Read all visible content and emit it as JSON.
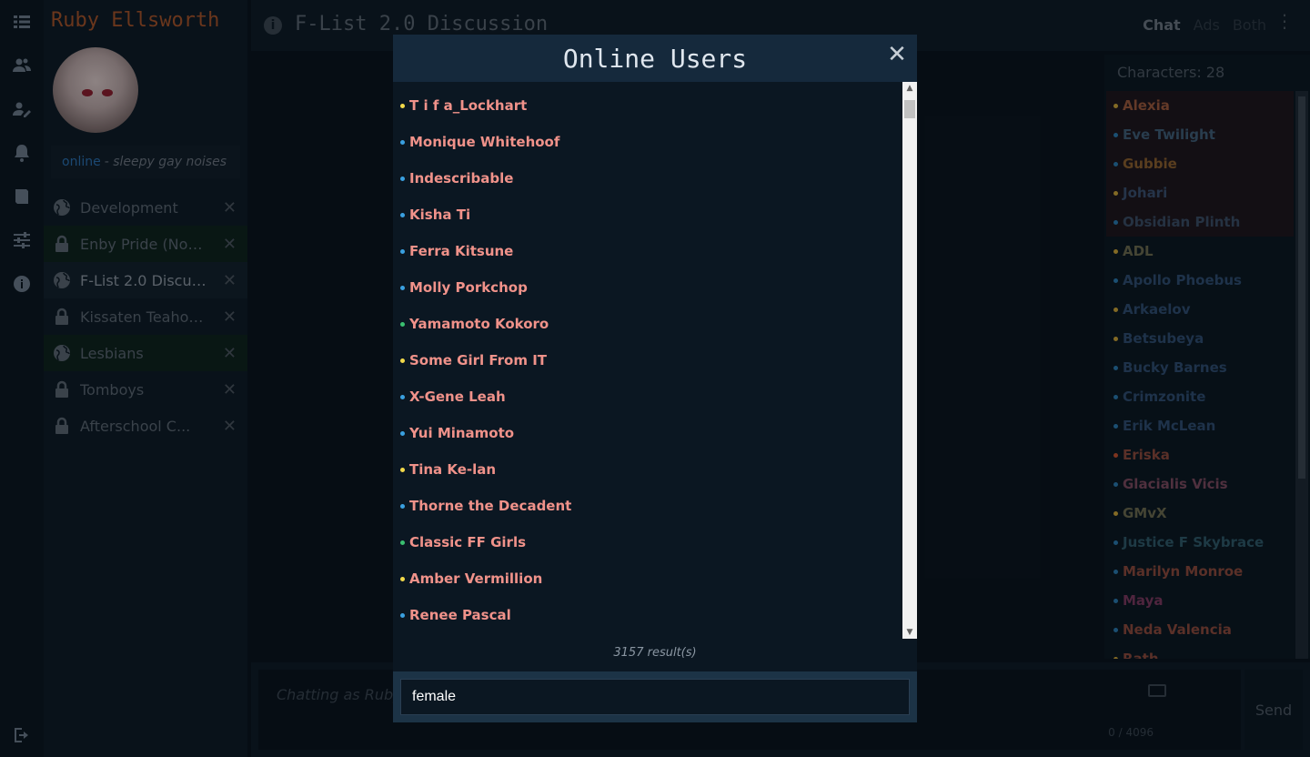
{
  "app": {
    "character_name": "Ruby Ellsworth",
    "status_word": "online",
    "status_message": "- sleepy gay noises"
  },
  "channels": [
    {
      "label": "Development",
      "icon": "globe-icon",
      "active": false,
      "green": false
    },
    {
      "label": "Enby Pride (Non...",
      "icon": "lock-icon",
      "active": false,
      "green": true
    },
    {
      "label": "F-List 2.0 Discus...",
      "icon": "globe-icon",
      "active": true,
      "green": false
    },
    {
      "label": "Kissaten Teahou...",
      "icon": "lock-icon",
      "active": false,
      "green": false
    },
    {
      "label": "Lesbians",
      "icon": "globe-icon",
      "active": false,
      "green": true
    },
    {
      "label": "Tomboys",
      "icon": "lock-icon",
      "active": false,
      "green": false
    },
    {
      "label": "Afterschool C...",
      "icon": "lock-icon",
      "active": false,
      "green": false
    }
  ],
  "header": {
    "title": "F-List 2.0 Discussion",
    "mode_chat": "Chat",
    "mode_ads": "Ads",
    "mode_both": "Both"
  },
  "userlist": {
    "count_label": "Characters: 28",
    "users": [
      {
        "name": "Alexia",
        "color": "#9a5a3e",
        "dot": "#c9a43a",
        "op": true
      },
      {
        "name": "Eve Twilight",
        "color": "#3f5e78",
        "dot": "#2a7ab0",
        "op": true
      },
      {
        "name": "Gubbie",
        "color": "#8a6030",
        "dot": "#2a7ab0",
        "op": true
      },
      {
        "name": "Johari",
        "color": "#3a5070",
        "dot": "#c9a43a",
        "op": true
      },
      {
        "name": "Obsidian Plinth",
        "color": "#3a4e66",
        "dot": "#2a7ab0",
        "op": true
      },
      {
        "name": "ADL",
        "color": "#6a6a50",
        "dot": "#c9a43a",
        "op": false
      },
      {
        "name": "Apollo Phoebus",
        "color": "#2e4e72",
        "dot": "#2a7ab0",
        "op": false
      },
      {
        "name": "Arkaelov",
        "color": "#2e4e72",
        "dot": "#c9a43a",
        "op": false
      },
      {
        "name": "Betsubeya",
        "color": "#2e4e72",
        "dot": "#c9a43a",
        "op": false
      },
      {
        "name": "Bucky Barnes",
        "color": "#2e4e72",
        "dot": "#2a7ab0",
        "op": false
      },
      {
        "name": "Crimzonite",
        "color": "#2e4e72",
        "dot": "#2a7ab0",
        "op": false
      },
      {
        "name": "Erik McLean",
        "color": "#2e4e72",
        "dot": "#2a7ab0",
        "op": false
      },
      {
        "name": "Eriska",
        "color": "#8a4a3e",
        "dot": "#c05030",
        "op": false
      },
      {
        "name": "Glacialis Vicis",
        "color": "#7a4a60",
        "dot": "#2a7ab0",
        "op": false
      },
      {
        "name": "GMvX",
        "color": "#6a6a50",
        "dot": "#c9a43a",
        "op": false
      },
      {
        "name": "Justice F Skybrace",
        "color": "#2e5a6a",
        "dot": "#2a7ab0",
        "op": false
      },
      {
        "name": "Marilyn Monroe",
        "color": "#8a4a3e",
        "dot": "#2a7ab0",
        "op": false
      },
      {
        "name": "Maya",
        "color": "#7a3a60",
        "dot": "#2a7ab0",
        "op": false
      },
      {
        "name": "Neda Valencia",
        "color": "#8a4a3e",
        "dot": "#2a7ab0",
        "op": false
      },
      {
        "name": "Rath",
        "color": "#8a4a3e",
        "dot": "#c9a43a",
        "op": false
      }
    ]
  },
  "composer": {
    "placeholder": "Chatting as Ruby E",
    "counter": "0 / 4096",
    "send_label": "Send"
  },
  "modal": {
    "title": "Online Users",
    "close_glyph": "✕",
    "results": "3157 result(s)",
    "search_value": "female",
    "users": [
      {
        "name": "T i f a_Lockhart",
        "dot": "#f2d94a"
      },
      {
        "name": "Monique Whitehoof",
        "dot": "#3aa0e0"
      },
      {
        "name": "Indescribable",
        "dot": "#3aa0e0"
      },
      {
        "name": "Kisha Ti",
        "dot": "#3aa0e0"
      },
      {
        "name": "Ferra Kitsune",
        "dot": "#3aa0e0"
      },
      {
        "name": "Molly Porkchop",
        "dot": "#3aa0e0"
      },
      {
        "name": "Yamamoto Kokoro",
        "dot": "#3ac070"
      },
      {
        "name": "Some Girl From IT",
        "dot": "#f2d94a"
      },
      {
        "name": "X-Gene Leah",
        "dot": "#3aa0e0"
      },
      {
        "name": "Yui Minamoto",
        "dot": "#3aa0e0"
      },
      {
        "name": "Tina Ke-lan",
        "dot": "#f2d94a"
      },
      {
        "name": "Thorne the Decadent",
        "dot": "#3aa0e0"
      },
      {
        "name": "Classic FF Girls",
        "dot": "#3ac070"
      },
      {
        "name": "Amber Vermillion",
        "dot": "#f2d94a"
      },
      {
        "name": "Renee Pascal",
        "dot": "#3aa0e0"
      }
    ]
  }
}
